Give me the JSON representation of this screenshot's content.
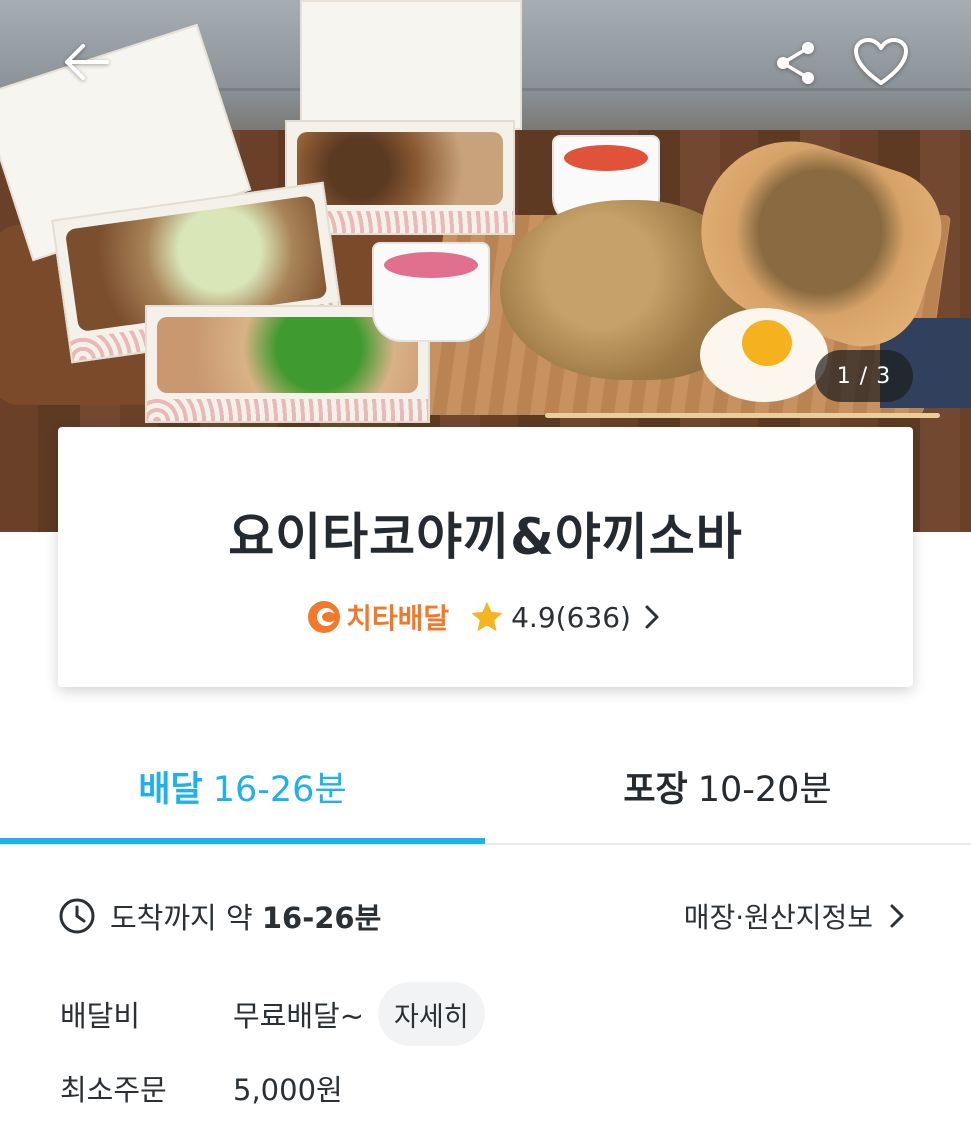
{
  "hero": {
    "counter": "1 / 3",
    "icons": {
      "back": "back-arrow-icon",
      "share": "share-icon",
      "favorite": "heart-icon"
    }
  },
  "store": {
    "name": "요이타코야끼&야끼소바",
    "badge_label": "치타배달",
    "badge_icon": "cheetah-logo-icon",
    "rating": "4.9(636)",
    "brand_color": "#f2792a",
    "star_color": "#f5b51e"
  },
  "tabs": [
    {
      "label": "배달",
      "time": "16-26분",
      "selected": true
    },
    {
      "label": "포장",
      "time": "10-20분",
      "selected": false
    }
  ],
  "accent_color": "#1fb2ea",
  "arrival": {
    "prefix": "도착까지 약 ",
    "time": "16-26분"
  },
  "store_info_link": "매장·원산지정보",
  "delivery_fee": {
    "label": "배달비",
    "value": "무료배달~",
    "detail_button": "자세히"
  },
  "min_order": {
    "label": "최소주문",
    "value": "5,000원"
  }
}
